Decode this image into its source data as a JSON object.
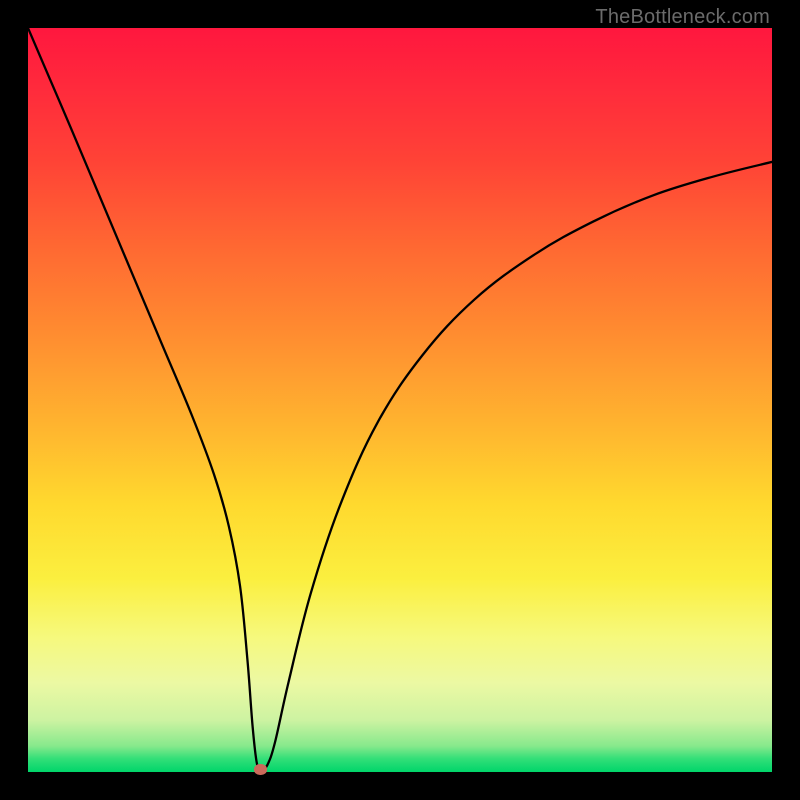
{
  "watermark": "TheBottleneck.com",
  "chart_data": {
    "type": "line",
    "title": "",
    "xlabel": "",
    "ylabel": "",
    "xlim": [
      0,
      100
    ],
    "ylim": [
      0,
      100
    ],
    "series": [
      {
        "name": "curve",
        "x": [
          0,
          3,
          6,
          10,
          14,
          18,
          22,
          25,
          27,
          28.5,
          29.5,
          30.2,
          30.8,
          31.5,
          32.2,
          33.2,
          35,
          38,
          42,
          47,
          53,
          60,
          68,
          76,
          84,
          92,
          100
        ],
        "values": [
          100,
          93,
          86,
          76.5,
          67,
          57.5,
          48,
          40,
          33,
          25,
          15,
          6,
          1,
          0.5,
          1,
          4,
          12,
          24,
          36,
          47,
          56,
          63.5,
          69.5,
          74,
          77.5,
          80,
          82
        ]
      }
    ],
    "marker": {
      "x": 31.3,
      "y": 0.4,
      "color": "#cb6a5b"
    },
    "gradient_bands": [
      "#ff173e",
      "#ffd92e",
      "#00d56a"
    ]
  }
}
